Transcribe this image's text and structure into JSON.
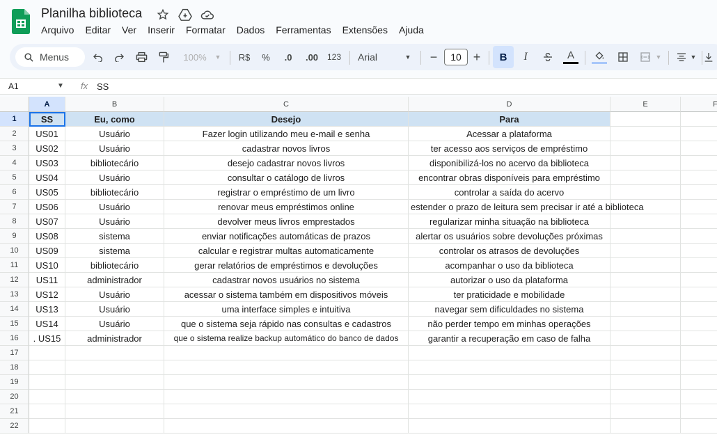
{
  "app": {
    "title": "Planilha biblioteca",
    "menus": [
      "Arquivo",
      "Editar",
      "Ver",
      "Inserir",
      "Formatar",
      "Dados",
      "Ferramentas",
      "Extensões",
      "Ajuda"
    ]
  },
  "toolbar": {
    "search_label": "Menus",
    "zoom": "100%",
    "currency": "R$",
    "percent": "%",
    "dec_less": ".0",
    "dec_more": ".00",
    "number_format": "123",
    "font": "Arial",
    "font_size": "10",
    "bold": "B",
    "italic": "I",
    "text_color_letter": "A"
  },
  "formula_bar": {
    "cell_ref": "A1",
    "fx": "fx",
    "value": "SS"
  },
  "columns": [
    "A",
    "B",
    "C",
    "D",
    "E",
    "F"
  ],
  "row_numbers": [
    "1",
    "2",
    "3",
    "4",
    "5",
    "6",
    "7",
    "8",
    "9",
    "10",
    "11",
    "12",
    "13",
    "14",
    "15",
    "16",
    "17",
    "18",
    "19",
    "20",
    "21",
    "22"
  ],
  "header_row": [
    "SS",
    "Eu, como",
    "Desejo",
    "Para"
  ],
  "rows": [
    [
      "US01",
      "Usuário",
      "Fazer login utilizando meu e-mail e senha",
      "Acessar a plataforma"
    ],
    [
      "US02",
      "Usuário",
      "cadastrar novos livros",
      "ter acesso aos serviços de empréstimo"
    ],
    [
      "US03",
      "bibliotecário",
      "desejo cadastrar novos livros",
      "disponibilizá-los no acervo da biblioteca"
    ],
    [
      "US04",
      "Usuário",
      "consultar o catálogo de livros",
      "encontrar obras disponíveis para empréstimo"
    ],
    [
      "US05",
      "bibliotecário",
      "registrar o empréstimo de um livro",
      "controlar a saída do acervo"
    ],
    [
      "US06",
      "Usuário",
      "renovar meus empréstimos online",
      "estender o prazo de leitura sem precisar ir até a biblioteca"
    ],
    [
      "US07",
      "Usuário",
      "devolver meus livros emprestados",
      "regularizar minha situação na biblioteca"
    ],
    [
      "US08",
      "sistema",
      "enviar notificações automáticas de prazos",
      "alertar os usuários sobre devoluções próximas"
    ],
    [
      "US09",
      "sistema",
      "calcular e registrar multas automaticamente",
      "controlar os atrasos de devoluções"
    ],
    [
      "US10",
      "bibliotecário",
      "gerar relatórios de empréstimos e devoluções",
      "acompanhar o uso da biblioteca"
    ],
    [
      "US11",
      "administrador",
      "cadastrar novos usuários no sistema",
      "autorizar o uso da plataforma"
    ],
    [
      "US12",
      "Usuário",
      "acessar o sistema também em dispositivos móveis",
      "ter praticidade e mobilidade"
    ],
    [
      "US13",
      "Usuário",
      "uma interface simples e intuitiva",
      "navegar sem dificuldades no sistema"
    ],
    [
      "US14",
      "Usuário",
      "que o sistema seja rápido nas consultas e cadastros",
      "não perder tempo em minhas operações"
    ],
    [
      ". US15",
      "administrador",
      "que o sistema realize backup automático do banco de dados",
      "garantir a recuperação em caso de falha"
    ]
  ]
}
